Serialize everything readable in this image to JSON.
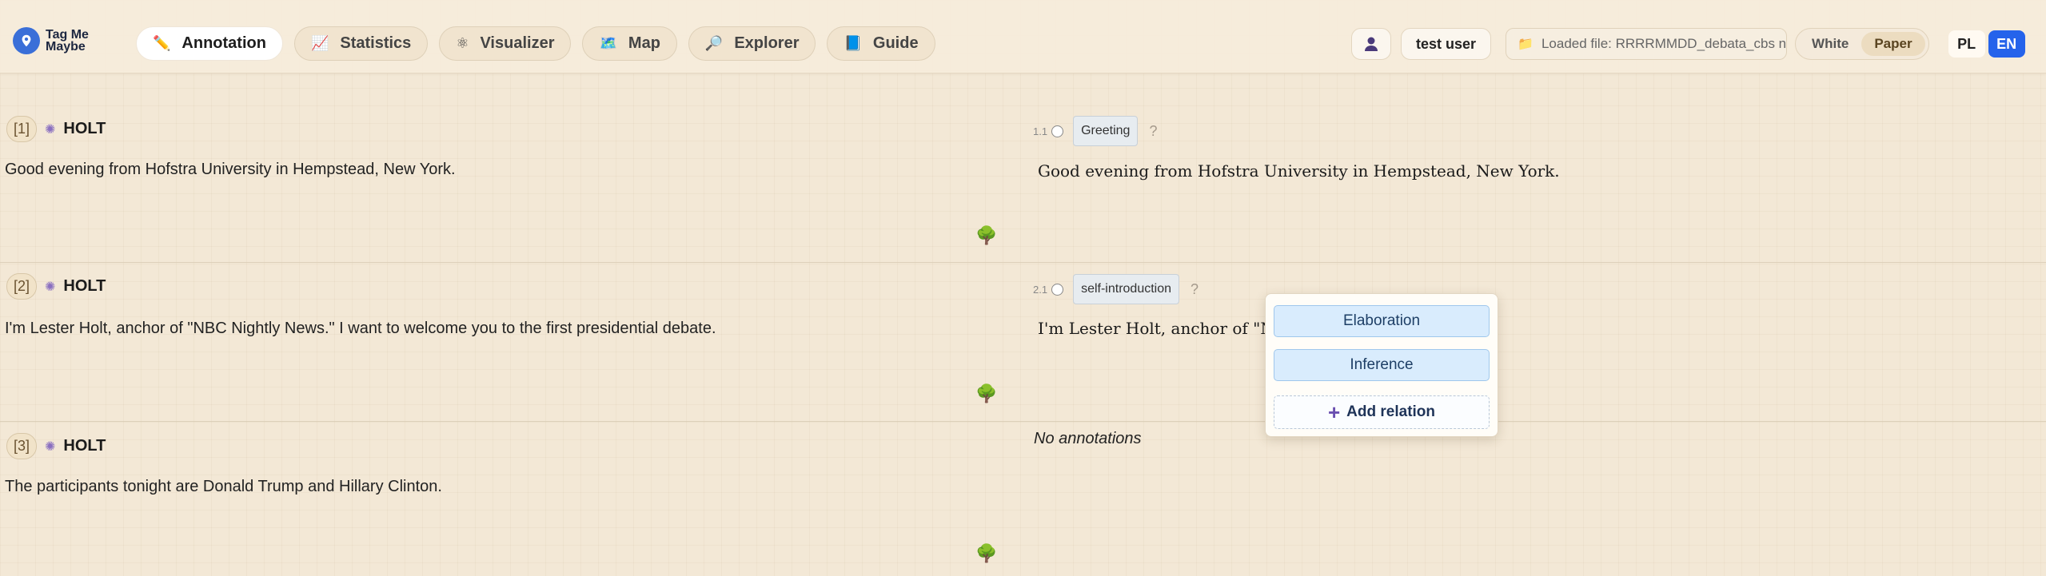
{
  "app": {
    "logo_text": "Tag Me Maybe"
  },
  "nav": [
    {
      "label": "Annotation",
      "icon": "✏️",
      "active": true
    },
    {
      "label": "Statistics",
      "icon": "📈",
      "active": false
    },
    {
      "label": "Visualizer",
      "icon": "⚛",
      "active": false
    },
    {
      "label": "Map",
      "icon": "🗺️",
      "active": false
    },
    {
      "label": "Explorer",
      "icon": "🔎",
      "active": false
    },
    {
      "label": "Guide",
      "icon": "📘",
      "active": false
    }
  ],
  "user": {
    "name": "test user"
  },
  "file": {
    "label": "Loaded file: RRRRMMDD_debata_cbs n"
  },
  "theme": {
    "white": "White",
    "paper": "Paper"
  },
  "lang": {
    "pl": "PL",
    "en": "EN"
  },
  "utterances": [
    {
      "index": "[1]",
      "speaker": "HOLT",
      "text": "Good evening from Hofstra University in Hempstead, New York.",
      "annotation": {
        "num": "1.1",
        "tag": "Greeting",
        "q": "?",
        "text": "Good evening from Hofstra University in Hempstead, New York."
      }
    },
    {
      "index": "[2]",
      "speaker": "HOLT",
      "text": "I'm Lester Holt, anchor of \"NBC Nightly News.\" I want to welcome you to the first presidential debate.",
      "annotation": {
        "num": "2.1",
        "tag": "self-introduction",
        "q": "?",
        "text": "I'm Lester Holt, anchor of \"NBC"
      }
    },
    {
      "index": "[3]",
      "speaker": "HOLT",
      "text": "The participants tonight are Donald Trump and Hillary Clinton.",
      "no_annotations": "No annotations"
    }
  ],
  "popup": {
    "relations": [
      "Elaboration",
      "Inference"
    ],
    "add_label": "Add relation"
  },
  "colors": {
    "accent": "#2563eb",
    "background": "#f3e8d6",
    "relation_fill": "#d9ecfd"
  }
}
